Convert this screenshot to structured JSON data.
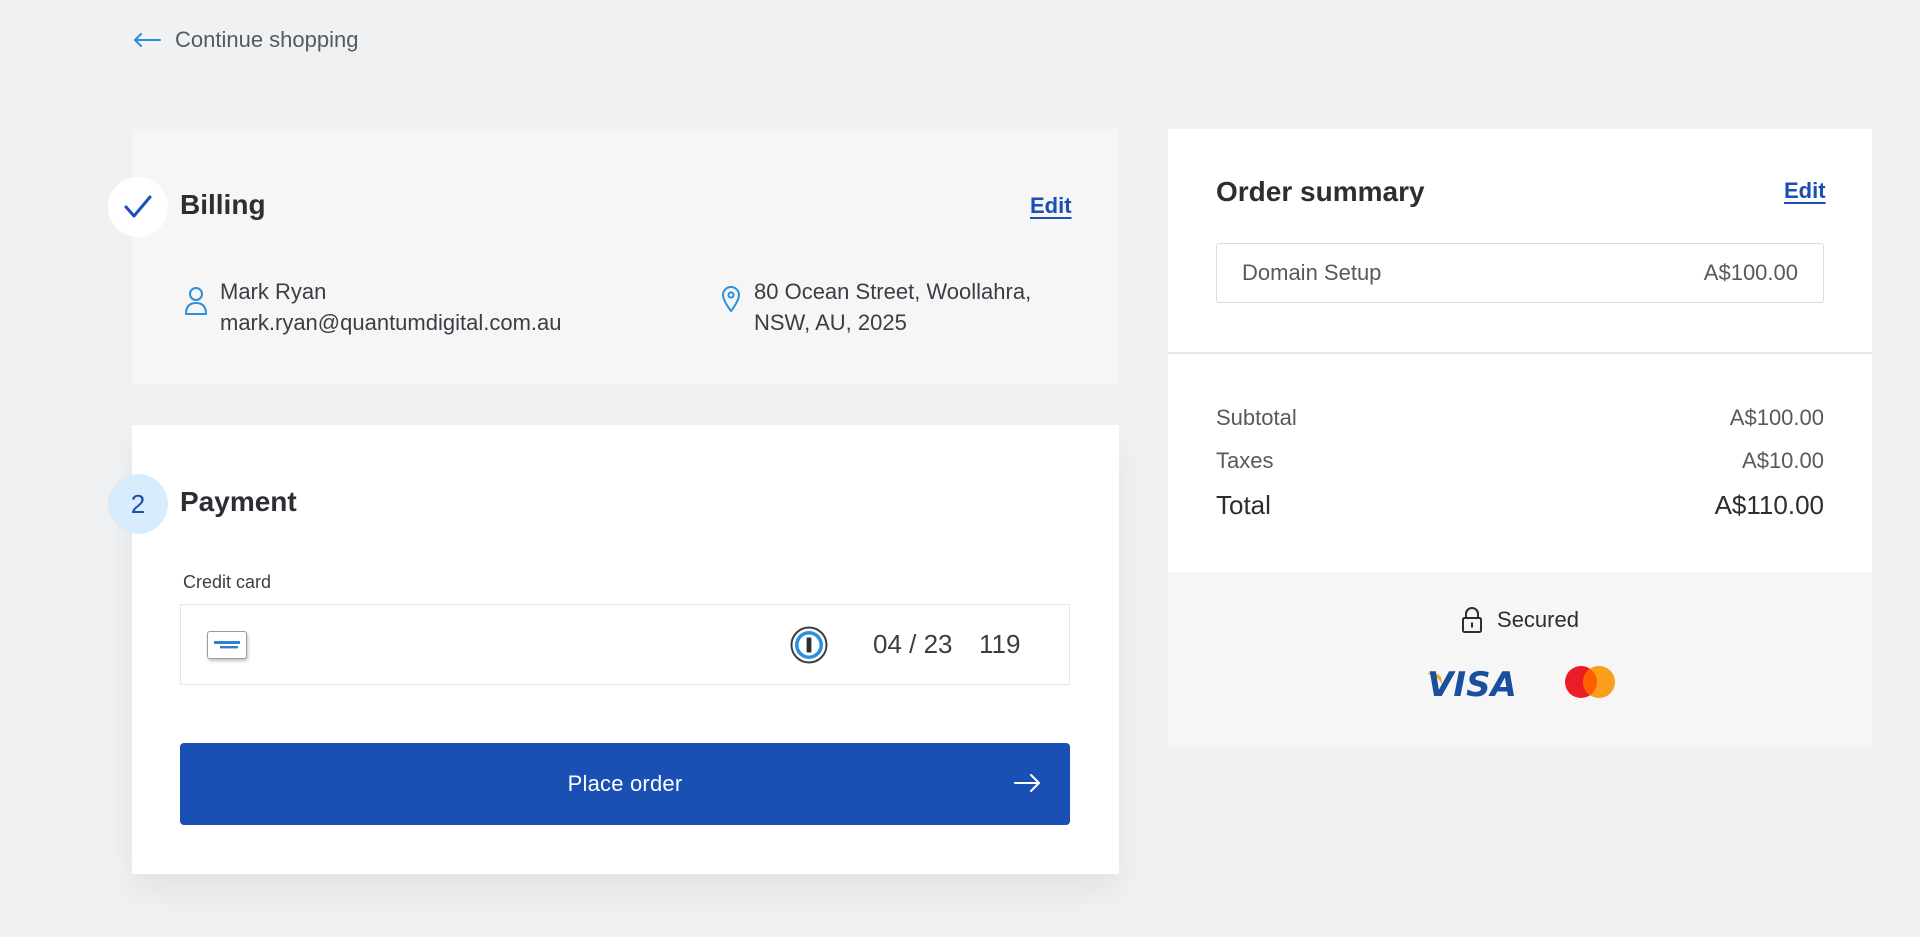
{
  "nav": {
    "back_label": "Continue shopping"
  },
  "billing": {
    "title": "Billing",
    "edit_label": "Edit",
    "name": "Mark Ryan",
    "email": "mark.ryan@quantumdigital.com.au",
    "address_line1": "80 Ocean Street, Woollahra,",
    "address_line2": "NSW, AU, 2025"
  },
  "payment": {
    "step_number": "2",
    "title": "Payment",
    "field_label": "Credit card",
    "card_brand_icon": "amex-card-icon",
    "expiry": "04 / 23",
    "cvc": "119",
    "place_order_label": "Place order"
  },
  "summary": {
    "title": "Order summary",
    "edit_label": "Edit",
    "items": [
      {
        "name": "Domain Setup",
        "price": "A$100.00"
      }
    ],
    "subtotal_label": "Subtotal",
    "subtotal_value": "A$100.00",
    "taxes_label": "Taxes",
    "taxes_value": "A$10.00",
    "total_label": "Total",
    "total_value": "A$110.00",
    "secured_label": "Secured",
    "accepted_cards": [
      "VISA",
      "mastercard"
    ]
  },
  "colors": {
    "accent": "#1a4fb4",
    "link_blue": "#2a8fdc",
    "page_bg": "#f0f1f3",
    "step_bg": "#d8ecfb"
  }
}
